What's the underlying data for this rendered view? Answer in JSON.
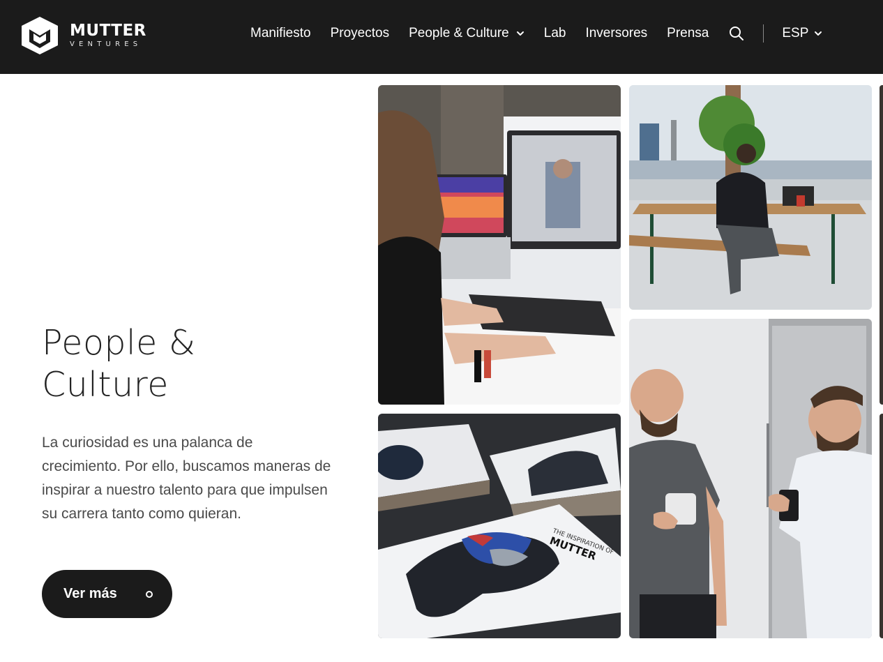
{
  "brand": {
    "name": "MUTTER",
    "subtitle": "VENTURES"
  },
  "nav": {
    "items": [
      {
        "label": "Manifiesto"
      },
      {
        "label": "Proyectos"
      },
      {
        "label": "People & Culture",
        "has_dropdown": true
      },
      {
        "label": "Lab"
      },
      {
        "label": "Inversores"
      },
      {
        "label": "Prensa"
      }
    ],
    "search_icon": "search-icon",
    "language": "ESP"
  },
  "hero": {
    "title_line1": "People &",
    "title_line2": "Culture",
    "text": "La curiosidad es una palanca de crecimiento. Por ello, buscamos maneras de inspirar a nuestro talento para que impulsen su carrera tanto como quieran.",
    "cta_label": "Ver más"
  },
  "gallery": {
    "book_cover_line1": "THE INSPIRATION OF",
    "book_cover_line2": "MUTTER"
  },
  "colors": {
    "header_bg": "#1b1b1b",
    "button_bg": "#1b1b1b",
    "text_dark": "#222222",
    "text_body": "#4a4a4a"
  }
}
